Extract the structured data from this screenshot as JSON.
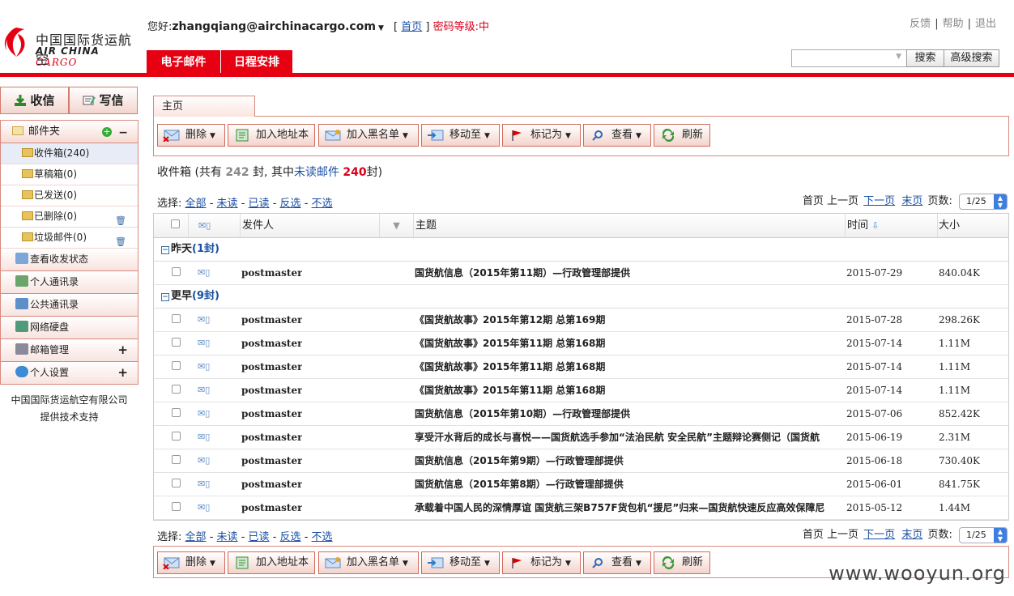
{
  "logo": {
    "cn": "中国国际货运航空",
    "en_left": "AIR CHINA",
    "en_right": "CARGO"
  },
  "user": {
    "greeting": "您好:",
    "email": "zhangqiang@airchinacargo.com",
    "home_bracket_open": "[",
    "home_link": "首页",
    "home_bracket_close": "]",
    "password_level": "密码等级:中"
  },
  "toplinks": {
    "feedback": "反馈",
    "help": "帮助",
    "logout": "退出",
    "sep": "|"
  },
  "nav": {
    "tabs": [
      {
        "label": "电子邮件"
      },
      {
        "label": "日程安排"
      }
    ]
  },
  "search": {
    "value": "",
    "search_button": "搜索",
    "advanced_button": "高级搜索"
  },
  "sidebar": {
    "receive": "收信",
    "compose": "写信",
    "folder_header": "邮件夹",
    "folders": [
      {
        "label": "收件箱(240)"
      },
      {
        "label": "草稿箱(0)"
      },
      {
        "label": "已发送(0)"
      },
      {
        "label": "已删除(0)"
      },
      {
        "label": "垃圾邮件(0)"
      }
    ],
    "sections": [
      {
        "label": "查看收发状态"
      },
      {
        "label": "个人通讯录"
      },
      {
        "label": "公共通讯录"
      },
      {
        "label": "网络硬盘"
      },
      {
        "label": "邮箱管理"
      },
      {
        "label": "个人设置"
      }
    ],
    "footer_line1": "中国国际货运航空有限公司",
    "footer_line2": "提供技术支持"
  },
  "main": {
    "home_tab": "主页",
    "toolbar": {
      "delete": "删除",
      "add_address": "加入地址本",
      "blacklist": "加入黑名单",
      "move_to": "移动至",
      "mark_as": "标记为",
      "view": "查看",
      "refresh": "刷新"
    },
    "summary": {
      "prefix": "收件箱 (共有",
      "total": "242",
      "mid": "封, 其中",
      "unread_label": "未读邮件",
      "unread": "240",
      "suffix": "封)"
    },
    "select": {
      "label": "选择:",
      "all": "全部",
      "unread": "未读",
      "read": "已读",
      "invert": "反选",
      "none": "不选",
      "dash": "-"
    },
    "pager": {
      "first": "首页",
      "prev": "上一页",
      "next": "下一页",
      "last": "末页",
      "pages_label": "页数:",
      "page_value": "1/25"
    },
    "columns": {
      "from": "发件人",
      "subject": "主题",
      "time": "时间",
      "size": "大小"
    },
    "groups": [
      {
        "name": "昨天",
        "count": "(1封)",
        "rows": [
          {
            "from": "postmaster",
            "subject": "国货航信息（2015年第11期）—行政管理部提供",
            "date": "2015-07-29",
            "size": "840.04K"
          }
        ]
      },
      {
        "name": "更早",
        "count": "(9封)",
        "rows": [
          {
            "from": "postmaster",
            "subject": "《国货航故事》2015年第12期 总第169期",
            "date": "2015-07-28",
            "size": "298.26K"
          },
          {
            "from": "postmaster",
            "subject": "《国货航故事》2015年第11期 总第168期",
            "date": "2015-07-14",
            "size": "1.11M"
          },
          {
            "from": "postmaster",
            "subject": "《国货航故事》2015年第11期 总第168期",
            "date": "2015-07-14",
            "size": "1.11M"
          },
          {
            "from": "postmaster",
            "subject": "《国货航故事》2015年第11期 总第168期",
            "date": "2015-07-14",
            "size": "1.11M"
          },
          {
            "from": "postmaster",
            "subject": "国货航信息（2015年第10期）—行政管理部提供",
            "date": "2015-07-06",
            "size": "852.42K"
          },
          {
            "from": "postmaster",
            "subject": "享受汗水背后的成长与喜悦——国货航选手参加“法治民航 安全民航”主题辩论赛侧记（国货航",
            "date": "2015-06-19",
            "size": "2.31M"
          },
          {
            "from": "postmaster",
            "subject": "国货航信息（2015年第9期）—行政管理部提供",
            "date": "2015-06-18",
            "size": "730.40K"
          },
          {
            "from": "postmaster",
            "subject": "国货航信息（2015年第8期）—行政管理部提供",
            "date": "2015-06-01",
            "size": "841.75K"
          },
          {
            "from": "postmaster",
            "subject": "承载着中国人民的深情厚谊 国货航三架B757F货包机“援尼”归来—国货航快速反应高效保障尼",
            "date": "2015-05-12",
            "size": "1.44M"
          }
        ]
      }
    ]
  },
  "watermark": "www.wooyun.org",
  "colors": {
    "brand_red": "#e60012",
    "link_blue": "#1a4fa3",
    "unread_red": "#d9001b"
  }
}
